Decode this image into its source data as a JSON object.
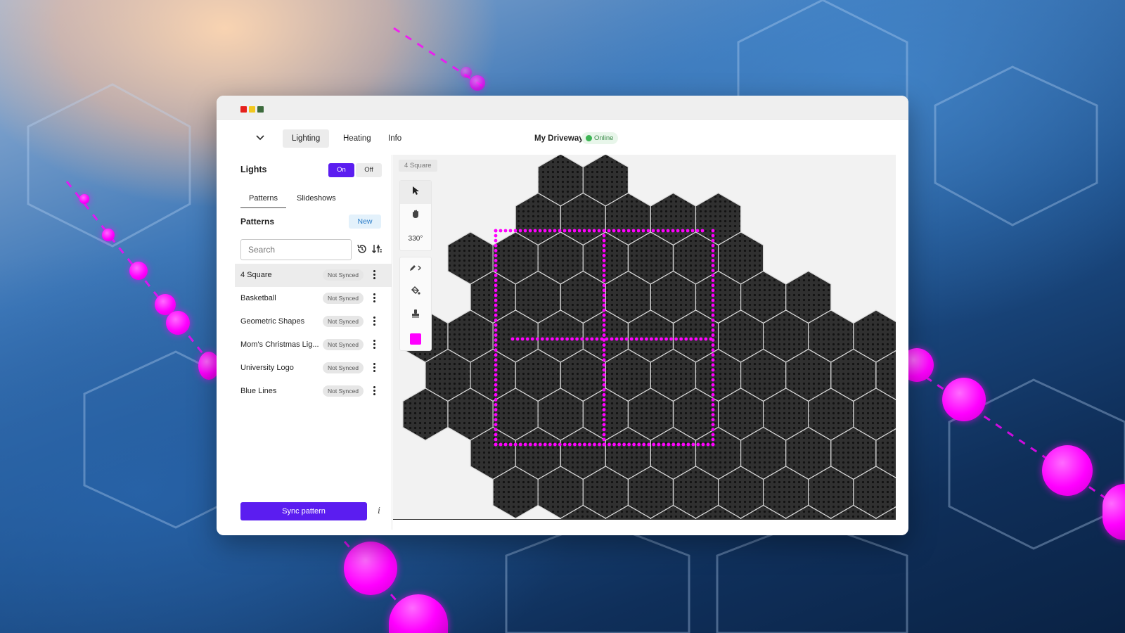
{
  "window": {
    "nav": {
      "tabs": [
        {
          "label": "Lighting",
          "active": true
        },
        {
          "label": "Heating",
          "active": false
        },
        {
          "label": "Info",
          "active": false
        }
      ],
      "site_name": "My Driveway",
      "status": "Online",
      "status_color": "#3db554"
    },
    "sidebar": {
      "lights_title": "Lights",
      "toggle": {
        "on_label": "On",
        "off_label": "Off",
        "selected": "On"
      },
      "subtabs": [
        {
          "label": "Patterns",
          "active": true
        },
        {
          "label": "Slideshows",
          "active": false
        }
      ],
      "patterns_heading": "Patterns",
      "new_label": "New",
      "search_placeholder": "Search",
      "patterns": [
        {
          "name": "4 Square",
          "status": "Not Synced",
          "selected": true
        },
        {
          "name": "Basketball",
          "status": "Not Synced",
          "selected": false
        },
        {
          "name": "Geometric Shapes",
          "status": "Not Synced",
          "selected": false
        },
        {
          "name": "Mom's Christmas Lig...",
          "status": "Not Synced",
          "selected": false
        },
        {
          "name": "University Logo",
          "status": "Not Synced",
          "selected": false
        },
        {
          "name": "Blue Lines",
          "status": "Not Synced",
          "selected": false
        }
      ],
      "sync_label": "Sync pattern",
      "info_icon": "i"
    },
    "canvas": {
      "pattern_label": "4 Square",
      "rotation": "330°",
      "tools": [
        "pointer-icon",
        "hand-icon",
        "pencil-icon",
        "fill-bucket-icon",
        "stamp-icon"
      ],
      "paint_color": "#ff00ff"
    }
  },
  "colors": {
    "accent": "#5b1df0",
    "tile": "#2a2a2a",
    "led_on": "#ff00ff"
  }
}
